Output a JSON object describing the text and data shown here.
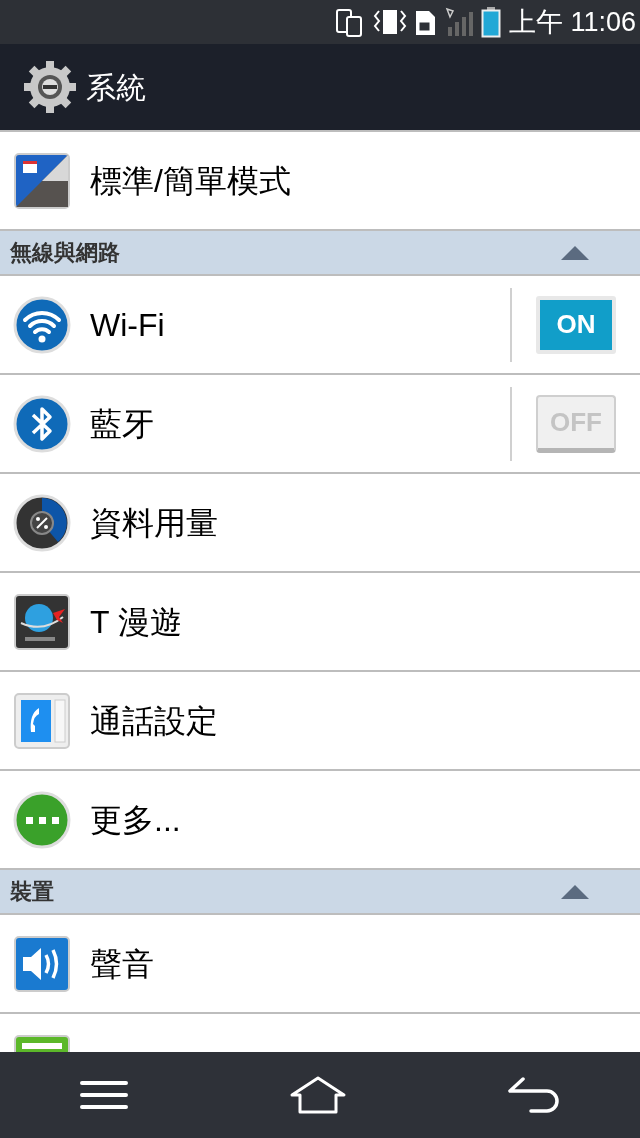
{
  "status_bar": {
    "time": "上午 11:06"
  },
  "header": {
    "title": "系統"
  },
  "groups": [
    {
      "items": [
        {
          "label": "標準/簡單模式",
          "kind": "item"
        }
      ]
    },
    {
      "title": "無線與網路",
      "expanded": true,
      "items": [
        {
          "label": "Wi-Fi",
          "kind": "toggle",
          "on": true,
          "toggle_label": "ON"
        },
        {
          "label": "藍牙",
          "kind": "toggle",
          "on": false,
          "toggle_label": "OFF"
        },
        {
          "label": "資料用量",
          "kind": "item"
        },
        {
          "label": "T 漫遊",
          "kind": "item"
        },
        {
          "label": "通話設定",
          "kind": "item"
        },
        {
          "label": "更多...",
          "kind": "item"
        }
      ]
    },
    {
      "title": "裝置",
      "expanded": true,
      "items": [
        {
          "label": "聲音",
          "kind": "item"
        }
      ]
    }
  ]
}
